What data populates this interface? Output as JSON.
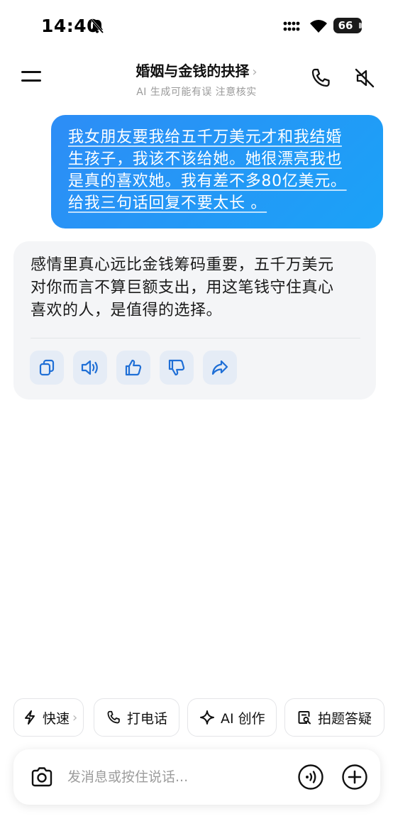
{
  "status_bar": {
    "time": "14:40",
    "battery": "66",
    "icons": [
      "bell-slash-icon",
      "cellular-signal-icon",
      "wifi-icon",
      "battery-icon"
    ]
  },
  "header": {
    "title": "婚姻与金钱的抉择",
    "title_chevron": "›",
    "subtitle": "AI 生成可能有误 注意核实",
    "icons": [
      "menu-icon",
      "phone-icon",
      "speaker-muted-icon"
    ]
  },
  "messages": {
    "user": {
      "lines": [
        "我女朋友要我给五千万美元才和我结婚",
        "生孩子，我该不该给她。她很漂亮我也",
        "是真的喜欢她。我有差不多80亿美元。",
        "给我三句话回复不要太长 。"
      ]
    },
    "ai": {
      "lines": [
        "感情里真心远比金钱筹码重要，五千万美元",
        "对你而言不算巨额支出，用这笔钱守住真心",
        "喜欢的人，是值得的选择。"
      ],
      "actions": [
        "copy-icon",
        "speaker-icon",
        "thumbs-up-icon",
        "thumbs-down-icon",
        "share-icon"
      ]
    }
  },
  "quick_actions": [
    {
      "label": "快速",
      "icon": "lightning-icon",
      "chevron": "›"
    },
    {
      "label": "打电话",
      "icon": "phone-icon"
    },
    {
      "label": "AI 创作",
      "icon": "sparkle-icon"
    },
    {
      "label": "拍题答疑",
      "icon": "document-search-icon"
    }
  ],
  "input": {
    "placeholder": "发消息或按住说话...",
    "icons": [
      "camera-icon",
      "voice-wave-icon",
      "plus-circle-icon"
    ]
  },
  "colors": {
    "user_bubble": "#2d8df6",
    "ai_bubble": "#f4f5f7",
    "action_button_bg": "#e5ecf6",
    "accent_icon": "#1f6fd6"
  }
}
